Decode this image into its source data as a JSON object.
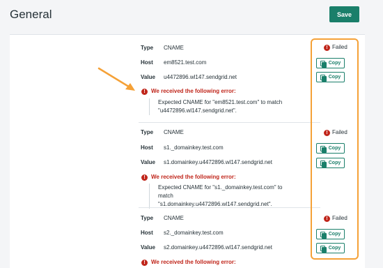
{
  "page": {
    "title": "General"
  },
  "toolbar": {
    "save_label": "Save"
  },
  "labels": {
    "type": "Type",
    "host": "Host",
    "value": "Value"
  },
  "copy_label": "Copy",
  "error_title": "We received the following error:",
  "records": [
    {
      "type": "CNAME",
      "host": "em8521.test.com",
      "value": "u4472896.wl147.sendgrid.net",
      "status": "Failed",
      "error_line1": "Expected CNAME for \"em8521.test.com\" to match",
      "error_line2": "\"u4472896.wl147.sendgrid.net\"."
    },
    {
      "type": "CNAME",
      "host": "s1._domainkey.test.com",
      "value": "s1.domainkey.u4472896.wl147.sendgrid.net",
      "status": "Failed",
      "error_line1": "Expected CNAME for \"s1._domainkey.test.com\" to match",
      "error_line2": "\"s1.domainkey.u4472896.wl147.sendgrid.net\"."
    },
    {
      "type": "CNAME",
      "host": "s2._domainkey.test.com",
      "value": "s2.domainkey.u4472896.wl147.sendgrid.net",
      "status": "Failed"
    }
  ],
  "colors": {
    "accent": "#1a7f6a",
    "error": "#c0261b",
    "highlight": "#f5a137"
  }
}
